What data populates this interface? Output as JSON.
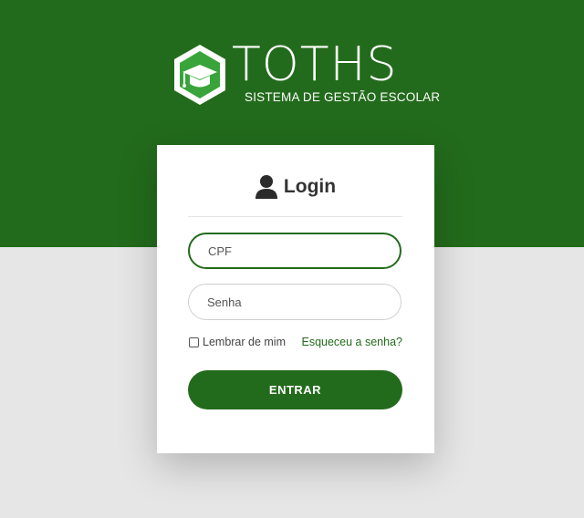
{
  "brand": {
    "name": "TOTHS",
    "tagline": "SISTEMA DE GESTÃO ESCOLAR",
    "primary_color": "#236b1c"
  },
  "login": {
    "title": "Login",
    "header_icon": "user-icon",
    "cpf_placeholder": "CPF",
    "senha_placeholder": "Senha",
    "remember_label": "Lembrar de mim",
    "forgot_label": "Esqueceu a senha?",
    "submit_label": "ENTRAR"
  }
}
